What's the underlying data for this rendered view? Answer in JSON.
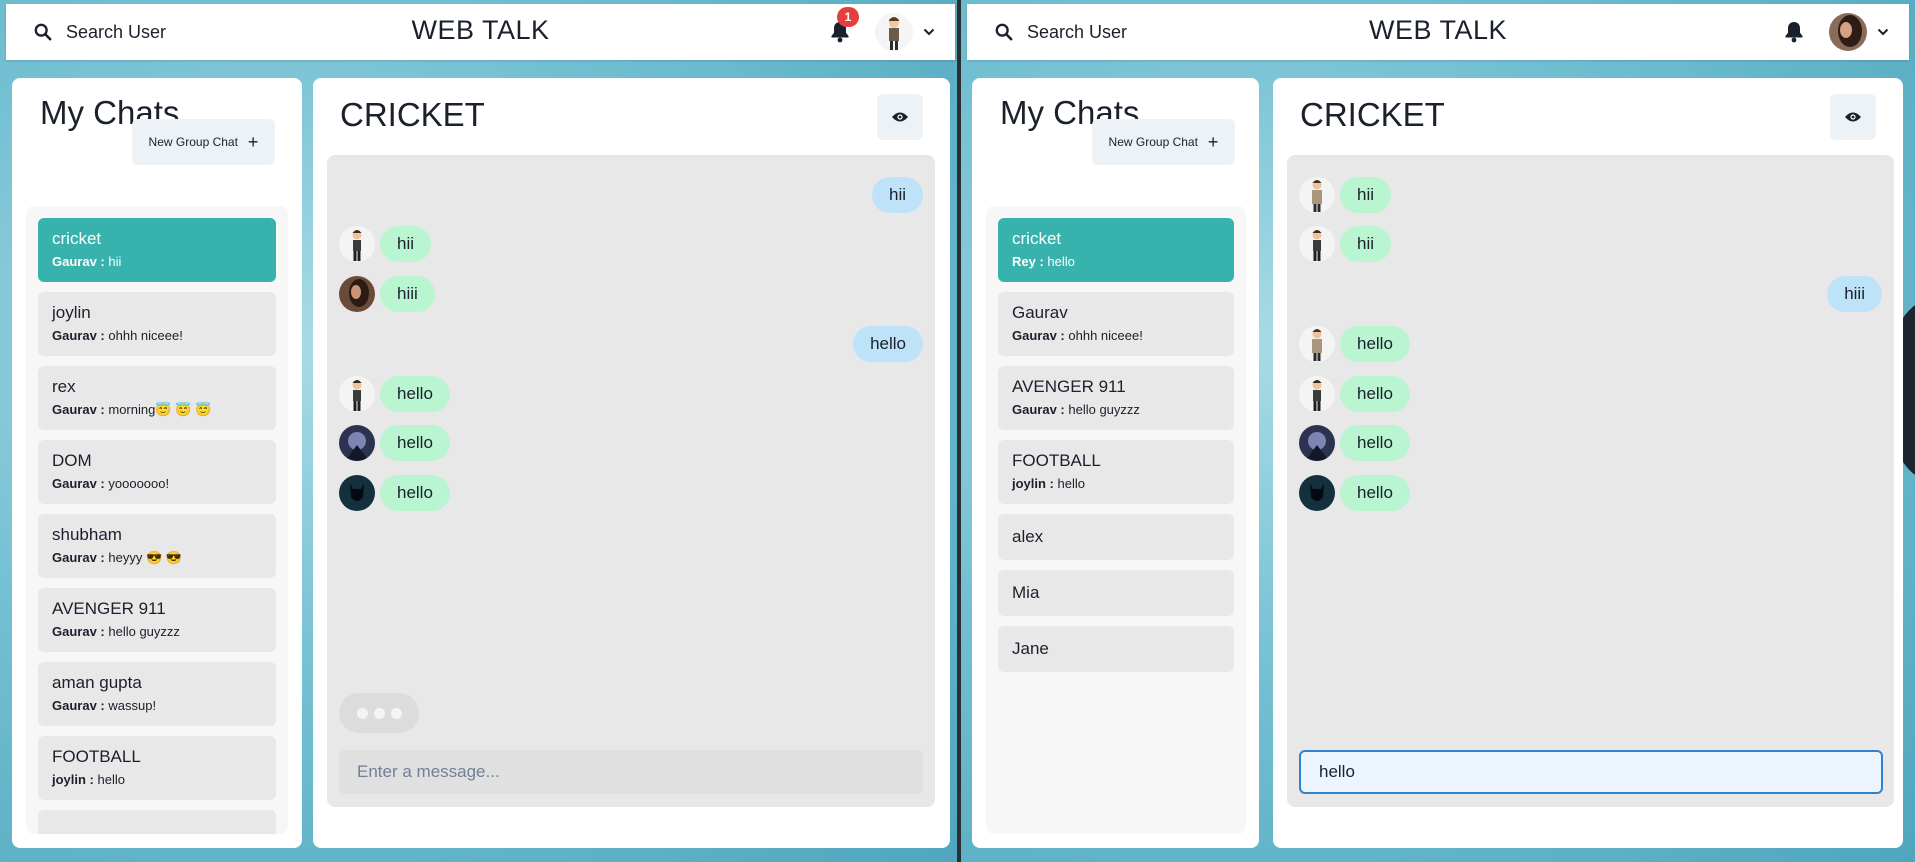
{
  "app": {
    "title": "WEB TALK",
    "search_label": "Search User"
  },
  "left": {
    "notification_count": "1",
    "sidebar_title": "My Chats",
    "new_group_label": "New Group Chat",
    "chats": [
      {
        "name": "cricket",
        "sender": "Gaurav :",
        "text": "hii",
        "active": true
      },
      {
        "name": "joylin",
        "sender": "Gaurav :",
        "text": "ohhh niceee!"
      },
      {
        "name": "rex",
        "sender": "Gaurav :",
        "text": "morning😇 😇 😇"
      },
      {
        "name": "DOM",
        "sender": "Gaurav :",
        "text": "yooooooo!"
      },
      {
        "name": "shubham",
        "sender": "Gaurav :",
        "text": "heyyy 😎 😎"
      },
      {
        "name": "AVENGER 911",
        "sender": "Gaurav :",
        "text": "hello guyzzz"
      },
      {
        "name": "aman gupta",
        "sender": "Gaurav :",
        "text": "wassup!"
      },
      {
        "name": "FOOTBALL",
        "sender": "joylin :",
        "text": "hello"
      }
    ],
    "chat_title": "CRICKET",
    "messages": [
      {
        "text": "hii",
        "mine": true
      },
      {
        "text": "hii",
        "avatar": "suit-man"
      },
      {
        "text": "hiii",
        "avatar": "woman"
      },
      {
        "text": "hello",
        "mine": true
      },
      {
        "text": "hello",
        "avatar": "suit-man"
      },
      {
        "text": "hello",
        "avatar": "dark-hero"
      },
      {
        "text": "hello",
        "avatar": "batman"
      }
    ],
    "input_placeholder": "Enter a message...",
    "input_value": ""
  },
  "right": {
    "sidebar_title": "My Chats",
    "new_group_label": "New Group Chat",
    "chats": [
      {
        "name": "cricket",
        "sender": "Rey :",
        "text": "hello",
        "active": true
      },
      {
        "name": "Gaurav",
        "sender": "Gaurav :",
        "text": "ohhh niceee!"
      },
      {
        "name": "AVENGER 911",
        "sender": "Gaurav :",
        "text": "hello guyzzz"
      },
      {
        "name": "FOOTBALL",
        "sender": "joylin :",
        "text": "hello"
      },
      {
        "name": "alex"
      },
      {
        "name": "Mia"
      },
      {
        "name": "Jane"
      }
    ],
    "chat_title": "CRICKET",
    "messages": [
      {
        "text": "hii",
        "avatar": "coat-man"
      },
      {
        "text": "hii",
        "avatar": "suit-man"
      },
      {
        "text": "hiii",
        "mine": true
      },
      {
        "text": "hello",
        "avatar": "coat-man"
      },
      {
        "text": "hello",
        "avatar": "suit-man"
      },
      {
        "text": "hello",
        "avatar": "dark-hero"
      },
      {
        "text": "hello",
        "avatar": "batman"
      }
    ],
    "input_placeholder": "Enter a message...",
    "input_value": "hello"
  },
  "colors": {
    "active_chat": "#38b2ac",
    "other_bubble": "#b9f5d0",
    "my_bubble": "#bee3f8",
    "badge": "#e53e3e"
  }
}
